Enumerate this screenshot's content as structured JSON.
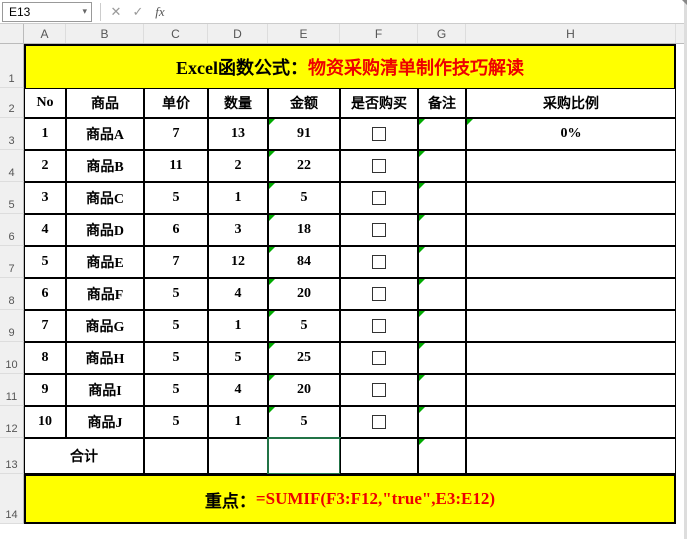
{
  "namebox": "E13",
  "formula": "",
  "col_labels": [
    "A",
    "B",
    "C",
    "D",
    "E",
    "F",
    "G",
    "H"
  ],
  "row_labels": [
    "1",
    "2",
    "3",
    "4",
    "5",
    "6",
    "7",
    "8",
    "9",
    "10",
    "11",
    "12",
    "13",
    "14"
  ],
  "title": {
    "prefix": "Excel函数公式：",
    "suffix": "物资采购清单制作技巧解读"
  },
  "headers": {
    "no": "No",
    "name": "商品",
    "price": "单价",
    "qty": "数量",
    "amount": "金额",
    "buy": "是否购买",
    "remark": "备注",
    "ratio": "采购比例"
  },
  "rows": [
    {
      "no": "1",
      "name": "商品A",
      "price": "7",
      "qty": "13",
      "amount": "91",
      "ratio": "0%"
    },
    {
      "no": "2",
      "name": "商品B",
      "price": "11",
      "qty": "2",
      "amount": "22",
      "ratio": ""
    },
    {
      "no": "3",
      "name": "商品C",
      "price": "5",
      "qty": "1",
      "amount": "5",
      "ratio": ""
    },
    {
      "no": "4",
      "name": "商品D",
      "price": "6",
      "qty": "3",
      "amount": "18",
      "ratio": ""
    },
    {
      "no": "5",
      "name": "商品E",
      "price": "7",
      "qty": "12",
      "amount": "84",
      "ratio": ""
    },
    {
      "no": "6",
      "name": "商品F",
      "price": "5",
      "qty": "4",
      "amount": "20",
      "ratio": ""
    },
    {
      "no": "7",
      "name": "商品G",
      "price": "5",
      "qty": "1",
      "amount": "5",
      "ratio": ""
    },
    {
      "no": "8",
      "name": "商品H",
      "price": "5",
      "qty": "5",
      "amount": "25",
      "ratio": ""
    },
    {
      "no": "9",
      "name": "商品I",
      "price": "5",
      "qty": "4",
      "amount": "20",
      "ratio": ""
    },
    {
      "no": "10",
      "name": "商品J",
      "price": "5",
      "qty": "1",
      "amount": "5",
      "ratio": ""
    }
  ],
  "totals": {
    "label": "合计",
    "amount": ""
  },
  "footer": {
    "prefix": "重点：",
    "formula": "=SUMIF(F3:F12,\"true\",E3:E12)"
  }
}
